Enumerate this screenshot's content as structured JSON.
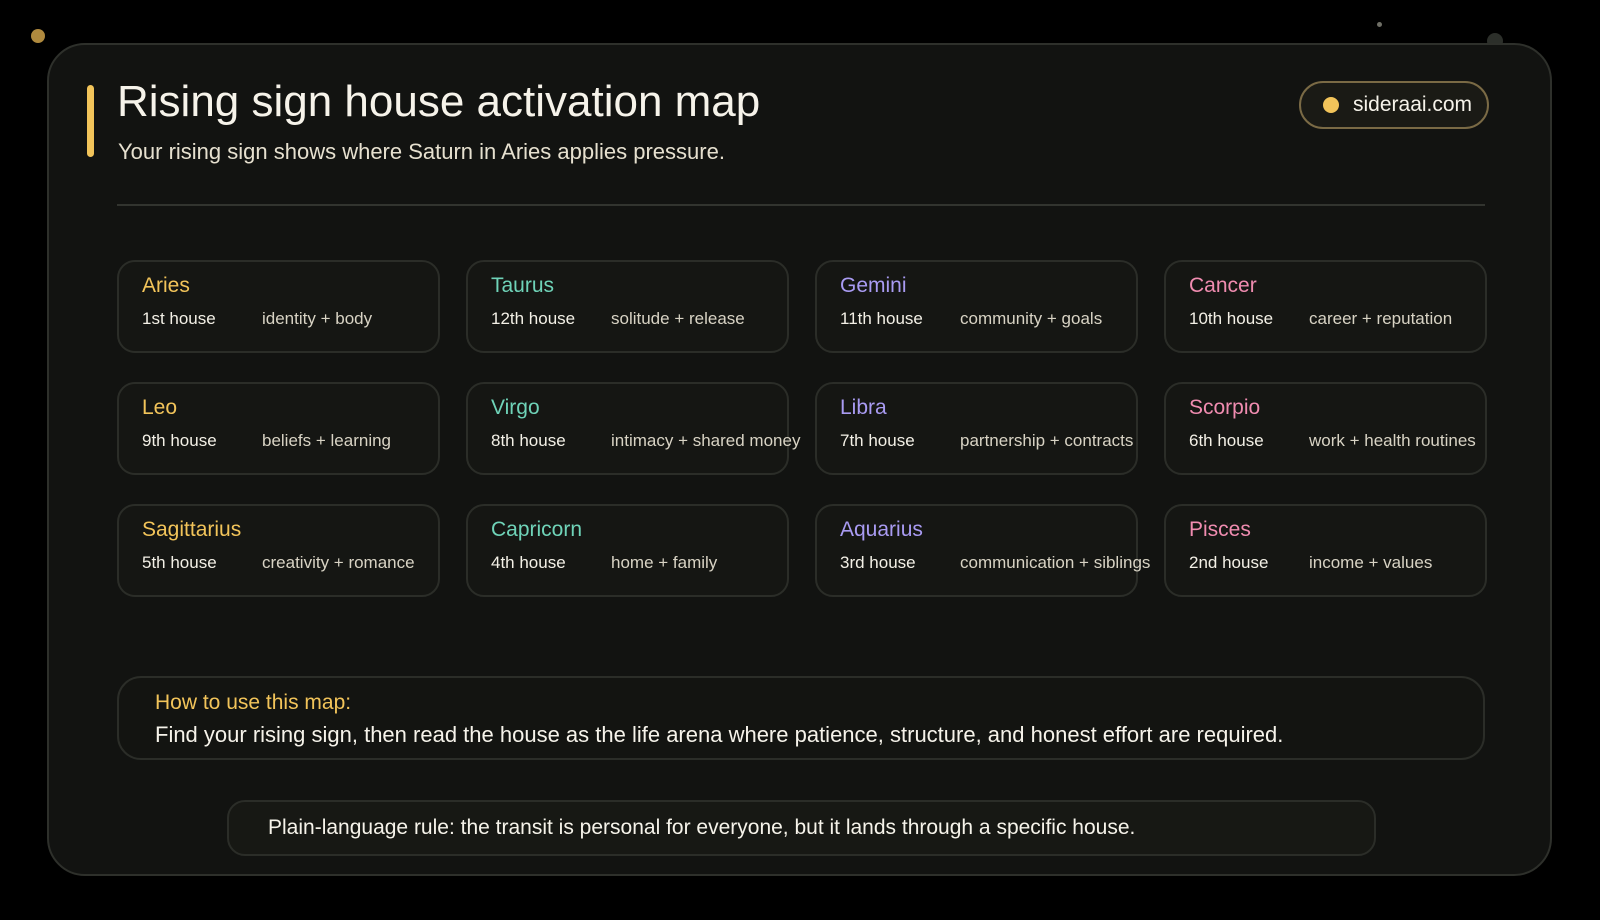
{
  "header": {
    "title": "Rising sign house activation map",
    "subtitle": "Your rising sign shows where Saturn in Aries applies pressure.",
    "site": "sideraai.com",
    "accent_color": "#f2c45a"
  },
  "signs": [
    {
      "sign": "Aries",
      "house": "1st house",
      "arena": "identity + body",
      "color": "#f2c45a"
    },
    {
      "sign": "Taurus",
      "house": "12th house",
      "arena": "solitude + release",
      "color": "#6fd3b8"
    },
    {
      "sign": "Gemini",
      "house": "11th house",
      "arena": "community + goals",
      "color": "#a99bf2"
    },
    {
      "sign": "Cancer",
      "house": "10th house",
      "arena": "career + reputation",
      "color": "#f08cb0"
    },
    {
      "sign": "Leo",
      "house": "9th house",
      "arena": "beliefs + learning",
      "color": "#f2c45a"
    },
    {
      "sign": "Virgo",
      "house": "8th house",
      "arena": "intimacy + shared money",
      "color": "#6fd3b8"
    },
    {
      "sign": "Libra",
      "house": "7th house",
      "arena": "partnership + contracts",
      "color": "#a99bf2"
    },
    {
      "sign": "Scorpio",
      "house": "6th house",
      "arena": "work + health routines",
      "color": "#f08cb0"
    },
    {
      "sign": "Sagittarius",
      "house": "5th house",
      "arena": "creativity + romance",
      "color": "#f2c45a"
    },
    {
      "sign": "Capricorn",
      "house": "4th house",
      "arena": "home + family",
      "color": "#6fd3b8"
    },
    {
      "sign": "Aquarius",
      "house": "3rd house",
      "arena": "communication + siblings",
      "color": "#a99bf2"
    },
    {
      "sign": "Pisces",
      "house": "2nd house",
      "arena": "income + values",
      "color": "#f08cb0"
    }
  ],
  "howto": {
    "title": "How to use this map:",
    "body": "Find your rising sign, then read the house as the life arena where patience, structure, and honest effort are required."
  },
  "rule": {
    "text": "Plain-language rule: the transit is personal for everyone, but it lands through a specific house."
  }
}
